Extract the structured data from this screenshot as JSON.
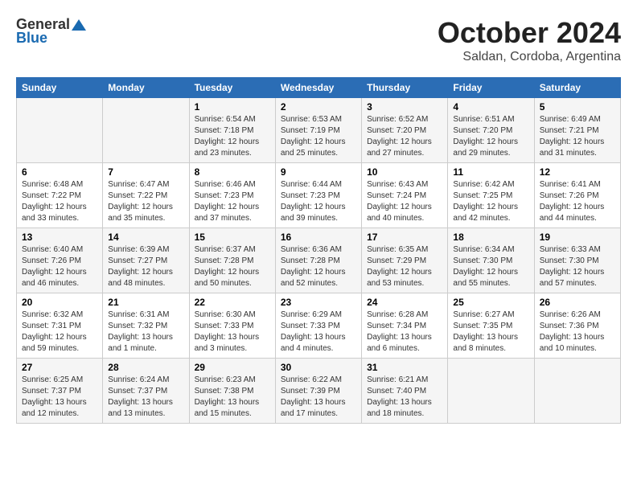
{
  "header": {
    "logo_general": "General",
    "logo_blue": "Blue",
    "title": "October 2024",
    "subtitle": "Saldan, Cordoba, Argentina"
  },
  "columns": [
    "Sunday",
    "Monday",
    "Tuesday",
    "Wednesday",
    "Thursday",
    "Friday",
    "Saturday"
  ],
  "weeks": [
    {
      "days": [
        {
          "num": "",
          "info": ""
        },
        {
          "num": "",
          "info": ""
        },
        {
          "num": "1",
          "info": "Sunrise: 6:54 AM\nSunset: 7:18 PM\nDaylight: 12 hours\nand 23 minutes."
        },
        {
          "num": "2",
          "info": "Sunrise: 6:53 AM\nSunset: 7:19 PM\nDaylight: 12 hours\nand 25 minutes."
        },
        {
          "num": "3",
          "info": "Sunrise: 6:52 AM\nSunset: 7:20 PM\nDaylight: 12 hours\nand 27 minutes."
        },
        {
          "num": "4",
          "info": "Sunrise: 6:51 AM\nSunset: 7:20 PM\nDaylight: 12 hours\nand 29 minutes."
        },
        {
          "num": "5",
          "info": "Sunrise: 6:49 AM\nSunset: 7:21 PM\nDaylight: 12 hours\nand 31 minutes."
        }
      ]
    },
    {
      "days": [
        {
          "num": "6",
          "info": "Sunrise: 6:48 AM\nSunset: 7:22 PM\nDaylight: 12 hours\nand 33 minutes."
        },
        {
          "num": "7",
          "info": "Sunrise: 6:47 AM\nSunset: 7:22 PM\nDaylight: 12 hours\nand 35 minutes."
        },
        {
          "num": "8",
          "info": "Sunrise: 6:46 AM\nSunset: 7:23 PM\nDaylight: 12 hours\nand 37 minutes."
        },
        {
          "num": "9",
          "info": "Sunrise: 6:44 AM\nSunset: 7:23 PM\nDaylight: 12 hours\nand 39 minutes."
        },
        {
          "num": "10",
          "info": "Sunrise: 6:43 AM\nSunset: 7:24 PM\nDaylight: 12 hours\nand 40 minutes."
        },
        {
          "num": "11",
          "info": "Sunrise: 6:42 AM\nSunset: 7:25 PM\nDaylight: 12 hours\nand 42 minutes."
        },
        {
          "num": "12",
          "info": "Sunrise: 6:41 AM\nSunset: 7:26 PM\nDaylight: 12 hours\nand 44 minutes."
        }
      ]
    },
    {
      "days": [
        {
          "num": "13",
          "info": "Sunrise: 6:40 AM\nSunset: 7:26 PM\nDaylight: 12 hours\nand 46 minutes."
        },
        {
          "num": "14",
          "info": "Sunrise: 6:39 AM\nSunset: 7:27 PM\nDaylight: 12 hours\nand 48 minutes."
        },
        {
          "num": "15",
          "info": "Sunrise: 6:37 AM\nSunset: 7:28 PM\nDaylight: 12 hours\nand 50 minutes."
        },
        {
          "num": "16",
          "info": "Sunrise: 6:36 AM\nSunset: 7:28 PM\nDaylight: 12 hours\nand 52 minutes."
        },
        {
          "num": "17",
          "info": "Sunrise: 6:35 AM\nSunset: 7:29 PM\nDaylight: 12 hours\nand 53 minutes."
        },
        {
          "num": "18",
          "info": "Sunrise: 6:34 AM\nSunset: 7:30 PM\nDaylight: 12 hours\nand 55 minutes."
        },
        {
          "num": "19",
          "info": "Sunrise: 6:33 AM\nSunset: 7:30 PM\nDaylight: 12 hours\nand 57 minutes."
        }
      ]
    },
    {
      "days": [
        {
          "num": "20",
          "info": "Sunrise: 6:32 AM\nSunset: 7:31 PM\nDaylight: 12 hours\nand 59 minutes."
        },
        {
          "num": "21",
          "info": "Sunrise: 6:31 AM\nSunset: 7:32 PM\nDaylight: 13 hours\nand 1 minute."
        },
        {
          "num": "22",
          "info": "Sunrise: 6:30 AM\nSunset: 7:33 PM\nDaylight: 13 hours\nand 3 minutes."
        },
        {
          "num": "23",
          "info": "Sunrise: 6:29 AM\nSunset: 7:33 PM\nDaylight: 13 hours\nand 4 minutes."
        },
        {
          "num": "24",
          "info": "Sunrise: 6:28 AM\nSunset: 7:34 PM\nDaylight: 13 hours\nand 6 minutes."
        },
        {
          "num": "25",
          "info": "Sunrise: 6:27 AM\nSunset: 7:35 PM\nDaylight: 13 hours\nand 8 minutes."
        },
        {
          "num": "26",
          "info": "Sunrise: 6:26 AM\nSunset: 7:36 PM\nDaylight: 13 hours\nand 10 minutes."
        }
      ]
    },
    {
      "days": [
        {
          "num": "27",
          "info": "Sunrise: 6:25 AM\nSunset: 7:37 PM\nDaylight: 13 hours\nand 12 minutes."
        },
        {
          "num": "28",
          "info": "Sunrise: 6:24 AM\nSunset: 7:37 PM\nDaylight: 13 hours\nand 13 minutes."
        },
        {
          "num": "29",
          "info": "Sunrise: 6:23 AM\nSunset: 7:38 PM\nDaylight: 13 hours\nand 15 minutes."
        },
        {
          "num": "30",
          "info": "Sunrise: 6:22 AM\nSunset: 7:39 PM\nDaylight: 13 hours\nand 17 minutes."
        },
        {
          "num": "31",
          "info": "Sunrise: 6:21 AM\nSunset: 7:40 PM\nDaylight: 13 hours\nand 18 minutes."
        },
        {
          "num": "",
          "info": ""
        },
        {
          "num": "",
          "info": ""
        }
      ]
    }
  ]
}
